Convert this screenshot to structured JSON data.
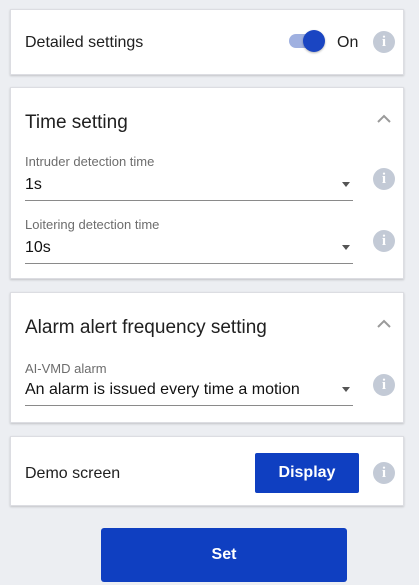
{
  "detailed_settings": {
    "label": "Detailed settings",
    "toggle_state": "On",
    "toggle_on": true
  },
  "time_setting": {
    "title": "Time setting",
    "fields": [
      {
        "label": "Intruder detection time",
        "value": "1s"
      },
      {
        "label": "Loitering detection time",
        "value": "10s"
      }
    ]
  },
  "alarm_setting": {
    "title": "Alarm alert frequency setting",
    "fields": [
      {
        "label": "AI-VMD alarm",
        "value": "An alarm is issued every time a motion"
      }
    ]
  },
  "demo": {
    "label": "Demo screen",
    "button_label": "Display"
  },
  "footer": {
    "set_label": "Set"
  },
  "colors": {
    "accent": "#0f3fc1",
    "info_icon": "#c3cad6",
    "background": "#eceef2"
  },
  "icons": [
    "info-icon",
    "chevron-up-icon",
    "dropdown-caret-icon"
  ]
}
